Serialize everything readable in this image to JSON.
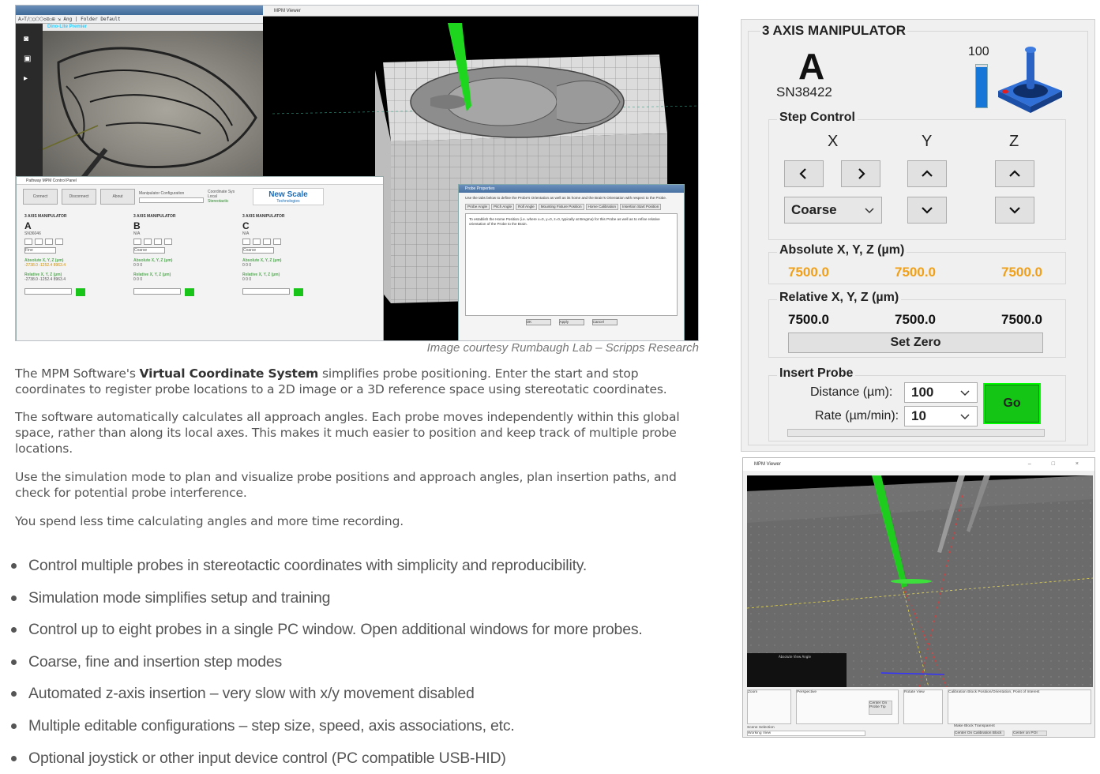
{
  "screenshot": {
    "dino_title": "Dino-Lite Premier",
    "dino_toolbar": "A↗T/⬚◯⬠⬡◇⊡▭⊞ ⇲ Ang | Folder Default",
    "viewer_title": "MPM Viewer",
    "control_panel_title": "Pathway MPM Control Panel",
    "control_buttons": [
      "Connect",
      "Disconnect",
      "About"
    ],
    "manipulator_config_label": "Manipulator Configuration",
    "coord_sys_label": "Coordinate Sys",
    "coord_options": [
      "Local",
      "Stereotactic"
    ],
    "logo_main": "New Scale",
    "logo_sub": "Technologies",
    "manipulators": [
      {
        "header": "3 AXIS MANIPULATOR",
        "letter": "A",
        "serial": "SN36046",
        "step": "Fine",
        "abs": "-2738.0   -1252.4   8963.4",
        "rel": "-2738.0   -1252.4   8963.4"
      },
      {
        "header": "3 AXIS MANIPULATOR",
        "letter": "B",
        "serial": "N/A",
        "step": "Coarse",
        "abs": "0   0   0",
        "rel": "0   0   0"
      },
      {
        "header": "3 AXIS MANIPULATOR",
        "letter": "C",
        "serial": "N/A",
        "step": "Coarse",
        "abs": "0   0   0",
        "rel": "0   0   0"
      }
    ],
    "props_title": "Probe Properties",
    "props_intro": "Use the tabs below to define the Probe's Orientation as well as its home and the Brain's Orientation with respect to the Probe.",
    "props_tabs": [
      "Probe Angle",
      "Pitch Angle",
      "Roll Angle",
      "Mounting Fixture Position",
      "Home Calibration",
      "Insertion Start Position"
    ],
    "props_text": "To establish the Home Position (i.e. where x=0, y=0, z=0, typically at Bregma) for this Probe as well as to refine relative orientation of the Probe to the Brain.",
    "props_buttons": [
      "OK",
      "Apply",
      "Cancel"
    ]
  },
  "caption": "Image courtesy Rumbaugh Lab – Scripps Research",
  "paragraphs": {
    "p1_pre": "The MPM Software's ",
    "p1_bold": "Virtual Coordinate System",
    "p1_post": " simplifies probe positioning. Enter the start and stop coordinates to register probe locations to a 2D image or a 3D reference space using stereotatic coordinates.",
    "p2": "The software automatically calculates all approach angles. Each probe moves independently within this global space, rather than along its local axes. This makes it much easier to position and keep track of multiple probe locations.",
    "p3": "Use the simulation mode to plan and visualize probe positions and approach angles, plan insertion paths, and check for potential probe interference.",
    "p4": "You spend less time calculating angles and more time recording."
  },
  "bullets": [
    "Control multiple probes in stereotactic coordinates with simplicity and reproducibility.",
    "Simulation mode simplifies setup and training",
    "Control up to eight probes in a single PC window. Open additional windows for more probes.",
    "Coarse, fine and insertion step modes",
    "Automated z-axis insertion – very slow with x/y movement disabled",
    "Multiple editable configurations – step size, speed, axis associations, etc.",
    "Optional joystick or other input device control (PC compatible USB-HID)"
  ],
  "manipulator_panel": {
    "title": "3 AXIS MANIPULATOR",
    "letter": "A",
    "serial": "SN38422",
    "level_label": "100",
    "level_fraction": 0.95,
    "step_control": {
      "title": "Step Control",
      "axis_x": "X",
      "axis_y": "Y",
      "axis_z": "Z",
      "step_mode": "Coarse"
    },
    "absolute": {
      "title": "Absolute X, Y, Z (µm)",
      "x": "7500.0",
      "y": "7500.0",
      "z": "7500.0"
    },
    "relative": {
      "title": "Relative X, Y, Z (µm)",
      "x": "7500.0",
      "y": "7500.0",
      "z": "7500.0"
    },
    "set_zero_label": "Set Zero",
    "insert_probe": {
      "title": "Insert Probe",
      "distance_label": "Distance (µm):",
      "distance_value": "100",
      "rate_label": "Rate (µm/min):",
      "rate_value": "10",
      "go_label": "Go"
    },
    "colors": {
      "orange_values": "#f0a018",
      "go_green": "#15c515",
      "level_blue": "#1577d8"
    }
  },
  "viewer2": {
    "title": "MPM Viewer",
    "window_controls": "– □ ×",
    "labels": [
      "Zoom",
      "Perspective",
      "Rotate View",
      "Calibration Block Position/Orientation, Point of Interest",
      "Scene Selection"
    ],
    "scene_value": "Working View",
    "buttons": [
      "Center On Probe Tip",
      "Center On Calibration Block",
      "Center on POI",
      "Make Block Transparent",
      "Follow Tip"
    ],
    "abs_view_label": "Absolute View Angle"
  }
}
